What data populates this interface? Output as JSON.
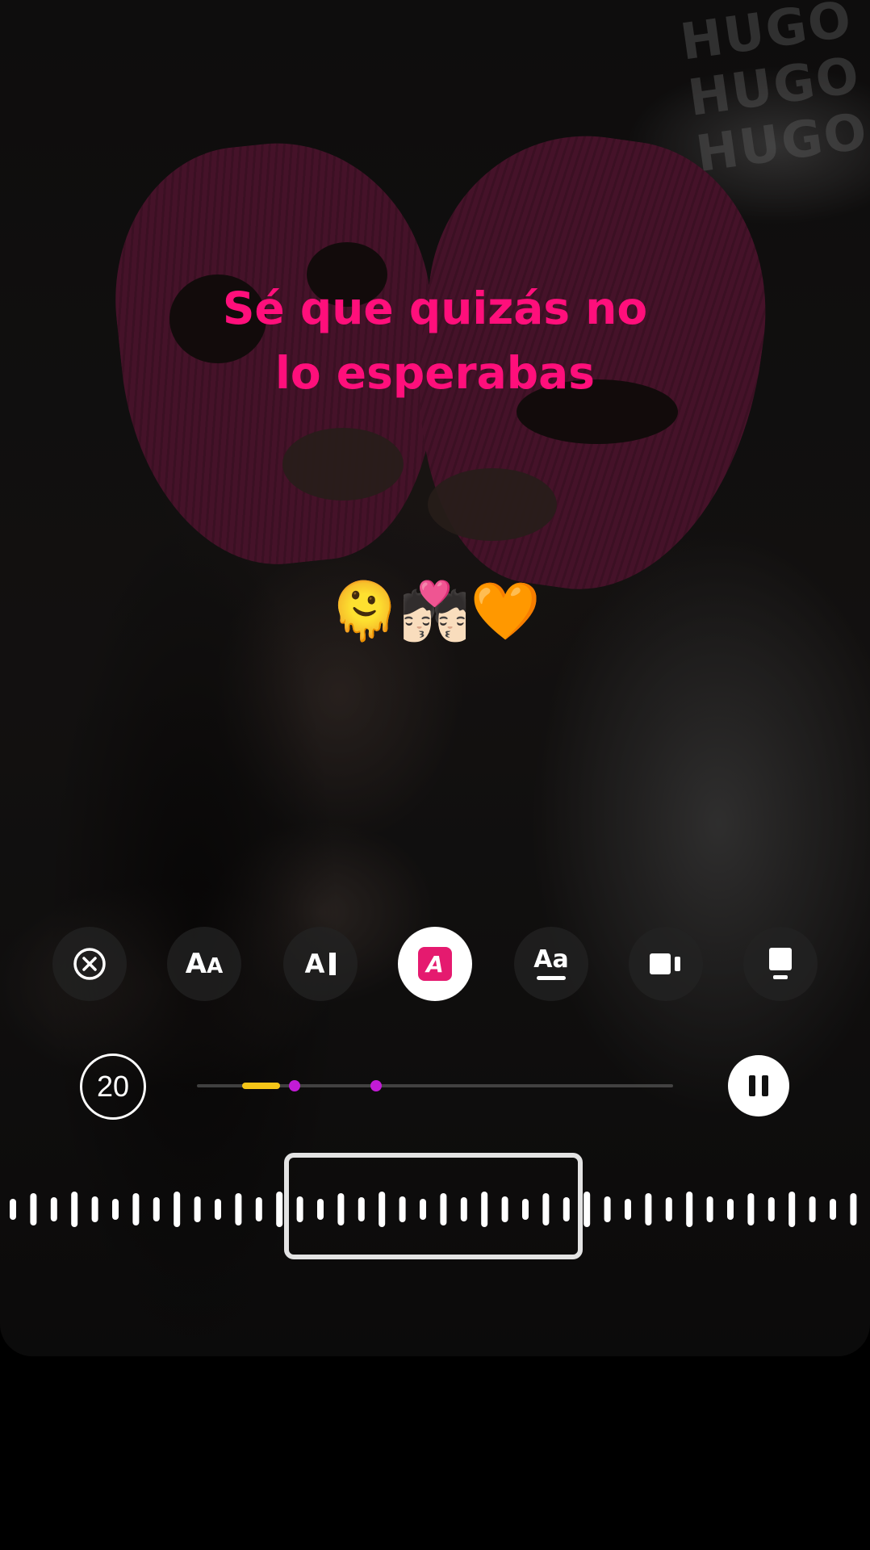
{
  "caption": {
    "line1": "Sé que quizás no",
    "line2": "lo esperabas",
    "emojis": "🫠💏🏻🧡"
  },
  "photo_text": {
    "cap_print": "HUGO HUGO HUGO"
  },
  "toolbar": {
    "font_size_big": "A",
    "font_size_small": "A",
    "text_bg_label": "A",
    "highlight_label": "A",
    "underline_label": "Aa",
    "buttons": [
      "close-icon",
      "font-size-icon",
      "text-background-icon",
      "highlight-icon",
      "underline-icon",
      "video-layout-icon",
      "card-layout-icon"
    ]
  },
  "playback": {
    "counter": "20",
    "progress_fraction": 0.08,
    "state": "playing"
  },
  "colors": {
    "caption": "#ff0f7b",
    "highlight_fill": "#e51a6f",
    "progress": "#f5c518",
    "markers": "#c21bd6"
  }
}
